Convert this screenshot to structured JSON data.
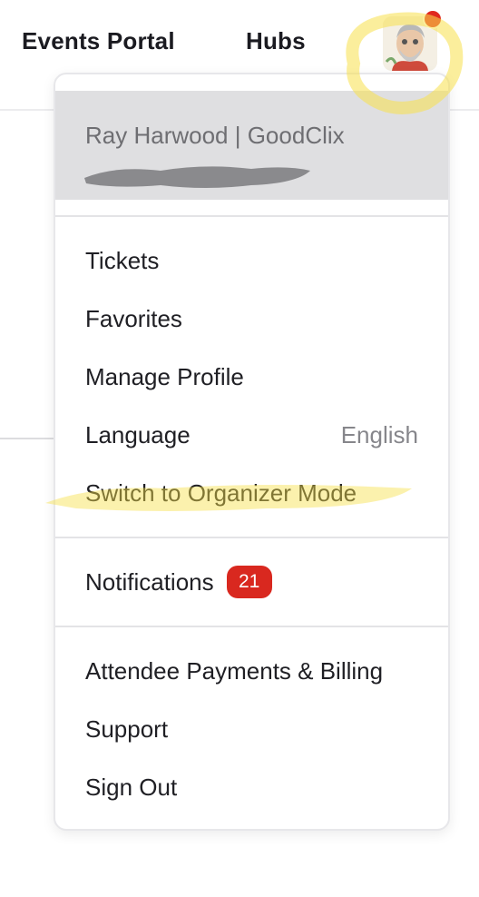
{
  "header": {
    "nav": [
      {
        "label": "Events Portal"
      },
      {
        "label": "Hubs"
      }
    ]
  },
  "colors": {
    "accent_red": "#d9281f",
    "highlighter": "#f7e04a",
    "user_block_bg": "#dfdfe1"
  },
  "menu": {
    "user": {
      "name": "Ray Harwood | GoodClix"
    },
    "items": [
      {
        "label": "Tickets"
      },
      {
        "label": "Favorites"
      },
      {
        "label": "Manage Profile"
      },
      {
        "label": "Language",
        "value": "English"
      },
      {
        "label": "Switch to Organizer Mode"
      }
    ],
    "notifications": {
      "label": "Notifications",
      "count": "21"
    },
    "footer_items": [
      {
        "label": "Attendee Payments & Billing"
      },
      {
        "label": "Support"
      },
      {
        "label": "Sign Out"
      }
    ]
  }
}
